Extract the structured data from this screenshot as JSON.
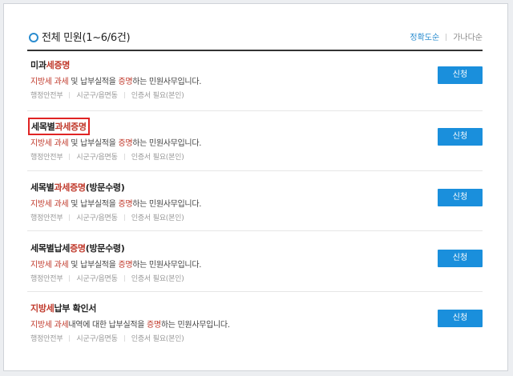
{
  "header": {
    "title": "전체 민원(1~6/6건)",
    "sort_active": "정확도순",
    "sort_other": "가나다순"
  },
  "items": [
    {
      "name_pre": "미과",
      "name_hl": "세증명",
      "name_post": "",
      "desc_hl": "지방세 과세",
      "desc_mid": " 및 납부실적을 ",
      "desc_hl2": "증명",
      "desc_post": "하는 민원사무입니다.",
      "org": "행정안전부",
      "office": "시군구/읍면동",
      "cert": "인증서 필요(본인)",
      "button": "신청"
    },
    {
      "name_pre": "세목별",
      "name_hl": "과세증명",
      "name_post": "",
      "desc_hl": "지방세 과세",
      "desc_mid": " 및 납부실적을 ",
      "desc_hl2": "증명",
      "desc_post": "하는 민원사무입니다.",
      "org": "행정안전부",
      "office": "시군구/읍면동",
      "cert": "인증서 필요(본인)",
      "button": "신청"
    },
    {
      "name_pre": "세목별",
      "name_hl": "과세증명",
      "name_post": "(방문수령)",
      "desc_hl": "지방세 과세",
      "desc_mid": " 및 납부실적을 ",
      "desc_hl2": "증명",
      "desc_post": "하는 민원사무입니다.",
      "org": "행정안전부",
      "office": "시군구/읍면동",
      "cert": "인증서 필요(본인)",
      "button": "신청"
    },
    {
      "name_pre": "세목별납세",
      "name_hl": "증명",
      "name_post": "(방문수령)",
      "desc_hl": "지방세 과세",
      "desc_mid": " 및 납부실적을 ",
      "desc_hl2": "증명",
      "desc_post": "하는 민원사무입니다.",
      "org": "행정안전부",
      "office": "시군구/읍면동",
      "cert": "인증서 필요(본인)",
      "button": "신청"
    },
    {
      "name_pre": "",
      "name_hl": "지방세",
      "name_post": "납부 확인서",
      "desc_hl": "지방세 과세",
      "desc_mid": "내역에 대한 납부실적을 ",
      "desc_hl2": "증명",
      "desc_post": "하는 민원사무입니다.",
      "org": "행정안전부",
      "office": "시군구/읍면동",
      "cert": "인증서 필요(본인)",
      "button": "신청"
    }
  ]
}
